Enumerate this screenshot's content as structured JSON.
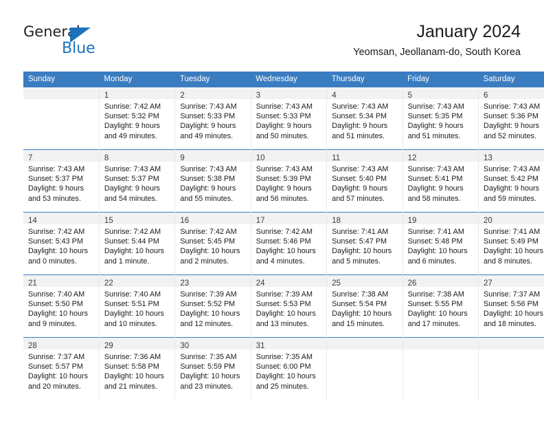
{
  "logo": {
    "word_top": "General",
    "word_bottom": "Blue",
    "triangle_color": "#1c72bb",
    "icon": "triangle-icon"
  },
  "header": {
    "title": "January 2024",
    "subtitle": "Yeomsan, Jeollanam-do, South Korea"
  },
  "theme": {
    "header_bg": "#3a7cc0",
    "header_text": "#ffffff",
    "daynum_band_bg": "#f2f2f2",
    "row_divider": "#3a7cc0",
    "cell_divider": "#e8e8e8"
  },
  "weekday_headers": [
    "Sunday",
    "Monday",
    "Tuesday",
    "Wednesday",
    "Thursday",
    "Friday",
    "Saturday"
  ],
  "weeks": [
    [
      {
        "day": "",
        "lines": []
      },
      {
        "day": "1",
        "lines": [
          "Sunrise: 7:42 AM",
          "Sunset: 5:32 PM",
          "Daylight: 9 hours",
          "and 49 minutes."
        ]
      },
      {
        "day": "2",
        "lines": [
          "Sunrise: 7:43 AM",
          "Sunset: 5:33 PM",
          "Daylight: 9 hours",
          "and 49 minutes."
        ]
      },
      {
        "day": "3",
        "lines": [
          "Sunrise: 7:43 AM",
          "Sunset: 5:33 PM",
          "Daylight: 9 hours",
          "and 50 minutes."
        ]
      },
      {
        "day": "4",
        "lines": [
          "Sunrise: 7:43 AM",
          "Sunset: 5:34 PM",
          "Daylight: 9 hours",
          "and 51 minutes."
        ]
      },
      {
        "day": "5",
        "lines": [
          "Sunrise: 7:43 AM",
          "Sunset: 5:35 PM",
          "Daylight: 9 hours",
          "and 51 minutes."
        ]
      },
      {
        "day": "6",
        "lines": [
          "Sunrise: 7:43 AM",
          "Sunset: 5:36 PM",
          "Daylight: 9 hours",
          "and 52 minutes."
        ]
      }
    ],
    [
      {
        "day": "7",
        "lines": [
          "Sunrise: 7:43 AM",
          "Sunset: 5:37 PM",
          "Daylight: 9 hours",
          "and 53 minutes."
        ]
      },
      {
        "day": "8",
        "lines": [
          "Sunrise: 7:43 AM",
          "Sunset: 5:37 PM",
          "Daylight: 9 hours",
          "and 54 minutes."
        ]
      },
      {
        "day": "9",
        "lines": [
          "Sunrise: 7:43 AM",
          "Sunset: 5:38 PM",
          "Daylight: 9 hours",
          "and 55 minutes."
        ]
      },
      {
        "day": "10",
        "lines": [
          "Sunrise: 7:43 AM",
          "Sunset: 5:39 PM",
          "Daylight: 9 hours",
          "and 56 minutes."
        ]
      },
      {
        "day": "11",
        "lines": [
          "Sunrise: 7:43 AM",
          "Sunset: 5:40 PM",
          "Daylight: 9 hours",
          "and 57 minutes."
        ]
      },
      {
        "day": "12",
        "lines": [
          "Sunrise: 7:43 AM",
          "Sunset: 5:41 PM",
          "Daylight: 9 hours",
          "and 58 minutes."
        ]
      },
      {
        "day": "13",
        "lines": [
          "Sunrise: 7:43 AM",
          "Sunset: 5:42 PM",
          "Daylight: 9 hours",
          "and 59 minutes."
        ]
      }
    ],
    [
      {
        "day": "14",
        "lines": [
          "Sunrise: 7:42 AM",
          "Sunset: 5:43 PM",
          "Daylight: 10 hours",
          "and 0 minutes."
        ]
      },
      {
        "day": "15",
        "lines": [
          "Sunrise: 7:42 AM",
          "Sunset: 5:44 PM",
          "Daylight: 10 hours",
          "and 1 minute."
        ]
      },
      {
        "day": "16",
        "lines": [
          "Sunrise: 7:42 AM",
          "Sunset: 5:45 PM",
          "Daylight: 10 hours",
          "and 2 minutes."
        ]
      },
      {
        "day": "17",
        "lines": [
          "Sunrise: 7:42 AM",
          "Sunset: 5:46 PM",
          "Daylight: 10 hours",
          "and 4 minutes."
        ]
      },
      {
        "day": "18",
        "lines": [
          "Sunrise: 7:41 AM",
          "Sunset: 5:47 PM",
          "Daylight: 10 hours",
          "and 5 minutes."
        ]
      },
      {
        "day": "19",
        "lines": [
          "Sunrise: 7:41 AM",
          "Sunset: 5:48 PM",
          "Daylight: 10 hours",
          "and 6 minutes."
        ]
      },
      {
        "day": "20",
        "lines": [
          "Sunrise: 7:41 AM",
          "Sunset: 5:49 PM",
          "Daylight: 10 hours",
          "and 8 minutes."
        ]
      }
    ],
    [
      {
        "day": "21",
        "lines": [
          "Sunrise: 7:40 AM",
          "Sunset: 5:50 PM",
          "Daylight: 10 hours",
          "and 9 minutes."
        ]
      },
      {
        "day": "22",
        "lines": [
          "Sunrise: 7:40 AM",
          "Sunset: 5:51 PM",
          "Daylight: 10 hours",
          "and 10 minutes."
        ]
      },
      {
        "day": "23",
        "lines": [
          "Sunrise: 7:39 AM",
          "Sunset: 5:52 PM",
          "Daylight: 10 hours",
          "and 12 minutes."
        ]
      },
      {
        "day": "24",
        "lines": [
          "Sunrise: 7:39 AM",
          "Sunset: 5:53 PM",
          "Daylight: 10 hours",
          "and 13 minutes."
        ]
      },
      {
        "day": "25",
        "lines": [
          "Sunrise: 7:38 AM",
          "Sunset: 5:54 PM",
          "Daylight: 10 hours",
          "and 15 minutes."
        ]
      },
      {
        "day": "26",
        "lines": [
          "Sunrise: 7:38 AM",
          "Sunset: 5:55 PM",
          "Daylight: 10 hours",
          "and 17 minutes."
        ]
      },
      {
        "day": "27",
        "lines": [
          "Sunrise: 7:37 AM",
          "Sunset: 5:56 PM",
          "Daylight: 10 hours",
          "and 18 minutes."
        ]
      }
    ],
    [
      {
        "day": "28",
        "lines": [
          "Sunrise: 7:37 AM",
          "Sunset: 5:57 PM",
          "Daylight: 10 hours",
          "and 20 minutes."
        ]
      },
      {
        "day": "29",
        "lines": [
          "Sunrise: 7:36 AM",
          "Sunset: 5:58 PM",
          "Daylight: 10 hours",
          "and 21 minutes."
        ]
      },
      {
        "day": "30",
        "lines": [
          "Sunrise: 7:35 AM",
          "Sunset: 5:59 PM",
          "Daylight: 10 hours",
          "and 23 minutes."
        ]
      },
      {
        "day": "31",
        "lines": [
          "Sunrise: 7:35 AM",
          "Sunset: 6:00 PM",
          "Daylight: 10 hours",
          "and 25 minutes."
        ]
      },
      {
        "day": "",
        "lines": []
      },
      {
        "day": "",
        "lines": []
      },
      {
        "day": "",
        "lines": []
      }
    ]
  ]
}
